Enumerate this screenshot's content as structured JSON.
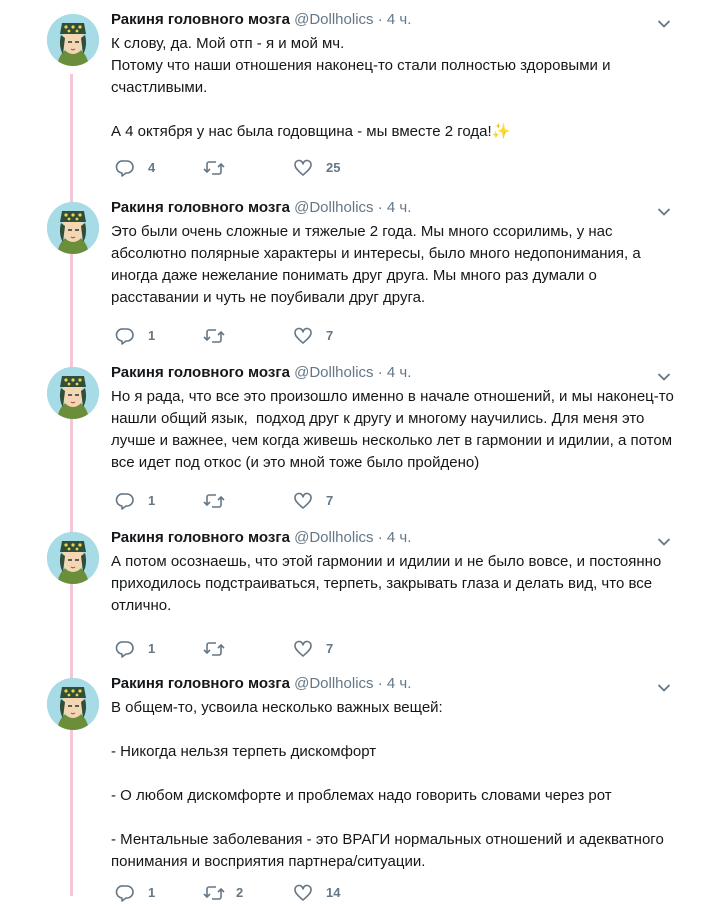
{
  "tweets": [
    {
      "name": "Ракиня головного мозга",
      "handle": "@Dollholics",
      "time": "4 ч.",
      "paragraphs": [
        "К слову, да. Мой отп - я и мой мч.\nПотому что наши отношения наконец-то стали полностью здоровыми и счастливыми.",
        "А 4 октября у нас была годовщина - мы вместе 2 года!✨"
      ],
      "replies": "4",
      "retweets": "",
      "likes": "25"
    },
    {
      "name": "Ракиня головного мозга",
      "handle": "@Dollholics",
      "time": "4 ч.",
      "paragraphs": [
        "Это были очень сложные и тяжелые 2 года. Мы много ссорилимь, у нас абсолютно полярные характеры и интересы, было много недопонимания, а иногда даже нежелание понимать друг друга. Мы много раз думали о расставании и чуть не поубивали друг друга."
      ],
      "replies": "1",
      "retweets": "",
      "likes": "7"
    },
    {
      "name": "Ракиня головного мозга",
      "handle": "@Dollholics",
      "time": "4 ч.",
      "paragraphs": [
        "Но я рада, что все это произошло именно в начале отношений, и мы наконец-то нашли общий язык,  подход друг к другу и многому научились. Для меня это лучше и важнее, чем когда живешь несколько лет в гармонии и идилии, а потом все идет под откос (и это мной тоже было пройдено)"
      ],
      "replies": "1",
      "retweets": "",
      "likes": "7"
    },
    {
      "name": "Ракиня головного мозга",
      "handle": "@Dollholics",
      "time": "4 ч.",
      "paragraphs": [
        "А потом осознаешь, что этой гармонии и идилии и не было вовсе, и постоянно приходилось подстраиваться, терпеть, закрывать глаза и делать вид, что все отлично."
      ],
      "replies": "1",
      "retweets": "",
      "likes": "7"
    },
    {
      "name": "Ракиня головного мозга",
      "handle": "@Dollholics",
      "time": "4 ч.",
      "paragraphs": [
        "В общем-то, усвоила несколько важных вещей:",
        "- Никогда нельзя терпеть дискомфорт",
        "- О любом дискомфорте и проблемах надо говорить словами через рот",
        "- Ментальные заболевания - это ВРАГИ нормальных отношений и адекватного понимания и восприятия партнера/ситуации."
      ],
      "replies": "1",
      "retweets": "2",
      "likes": "14"
    }
  ],
  "separator": "·",
  "colors": {
    "thread_line": "#f5c6d9",
    "secondary_text": "#657786",
    "primary_text": "#14171a"
  },
  "icons": {
    "reply": "reply-icon",
    "retweet": "retweet-icon",
    "like": "heart-icon",
    "menu": "chevron-down-icon"
  }
}
